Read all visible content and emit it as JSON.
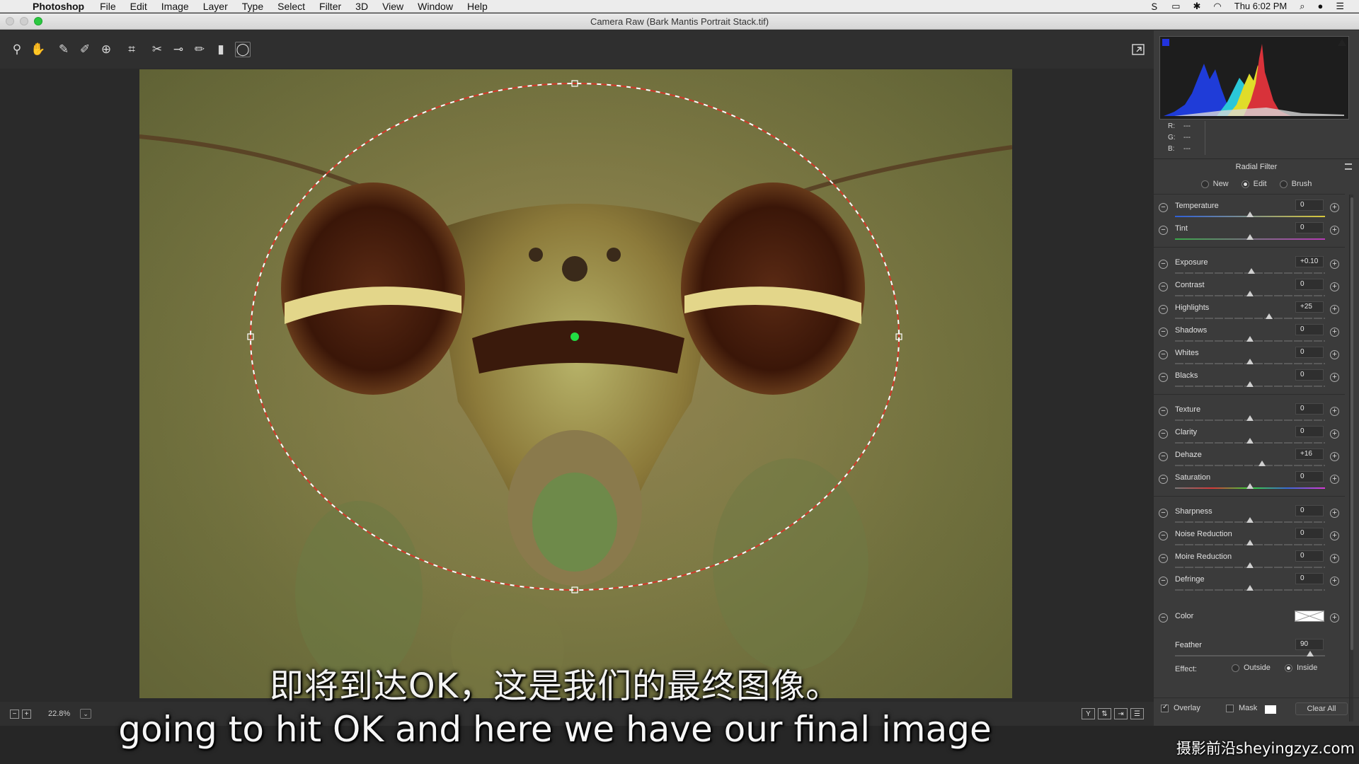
{
  "menubar": {
    "app": "Photoshop",
    "items": [
      "File",
      "Edit",
      "Image",
      "Layer",
      "Type",
      "Select",
      "Filter",
      "3D",
      "View",
      "Window",
      "Help"
    ],
    "clock": "Thu 6:02 PM"
  },
  "window": {
    "title": "Camera Raw (Bark Mantis Portrait Stack.tif)"
  },
  "toolbar": {
    "tools": [
      "zoom-icon",
      "hand-icon",
      "white-balance-icon",
      "color-sampler-icon",
      "targeted-adjustment-icon",
      "crop-icon",
      "straighten-icon",
      "spot-removal-icon",
      "brush-icon",
      "graduated-filter-icon",
      "radial-filter-icon"
    ]
  },
  "status": {
    "zoom": "22.8%"
  },
  "readout": {
    "r_label": "R:",
    "r": "---",
    "g_label": "G:",
    "g": "---",
    "b_label": "B:",
    "b": "---"
  },
  "panel": {
    "title": "Radial Filter",
    "modes": {
      "new": "New",
      "edit": "Edit",
      "brush": "Brush",
      "selected": "Edit"
    },
    "sliders": [
      {
        "label": "Temperature",
        "value": "0",
        "position": 0.5
      },
      {
        "label": "Tint",
        "value": "0",
        "position": 0.5
      },
      {
        "label": "Exposure",
        "value": "+0.10",
        "position": 0.51
      },
      {
        "label": "Contrast",
        "value": "0",
        "position": 0.5
      },
      {
        "label": "Highlights",
        "value": "+25",
        "position": 0.625
      },
      {
        "label": "Shadows",
        "value": "0",
        "position": 0.5
      },
      {
        "label": "Whites",
        "value": "0",
        "position": 0.5
      },
      {
        "label": "Blacks",
        "value": "0",
        "position": 0.5
      },
      {
        "label": "Texture",
        "value": "0",
        "position": 0.5
      },
      {
        "label": "Clarity",
        "value": "0",
        "position": 0.5
      },
      {
        "label": "Dehaze",
        "value": "+16",
        "position": 0.58
      },
      {
        "label": "Saturation",
        "value": "0",
        "position": 0.5
      },
      {
        "label": "Sharpness",
        "value": "0",
        "position": 0.5
      },
      {
        "label": "Noise Reduction",
        "value": "0",
        "position": 0.5
      },
      {
        "label": "Moire Reduction",
        "value": "0",
        "position": 0.5
      },
      {
        "label": "Defringe",
        "value": "0",
        "position": 0.5
      }
    ],
    "color_label": "Color",
    "color_swatch": "#ffffff",
    "feather_label": "Feather",
    "feather_value": "90",
    "feather_position": 0.9,
    "effect_label": "Effect:",
    "effect_outside": "Outside",
    "effect_inside": "Inside",
    "effect_selected": "Inside",
    "overlay_label": "Overlay",
    "overlay_checked": true,
    "mask_label": "Mask",
    "mask_checked": false,
    "clear_all": "Clear All"
  },
  "subtitles": {
    "chinese": "即将到达OK，这是我们的最终图像。",
    "english": "going to hit OK and here we have our final image"
  },
  "watermark": "摄影前沿sheyingzyz.com",
  "colors": {
    "panel_bg": "#3b3b3b",
    "canvas_bg": "#2a2a2a",
    "overlay_ellipse": "#d23a2a"
  }
}
